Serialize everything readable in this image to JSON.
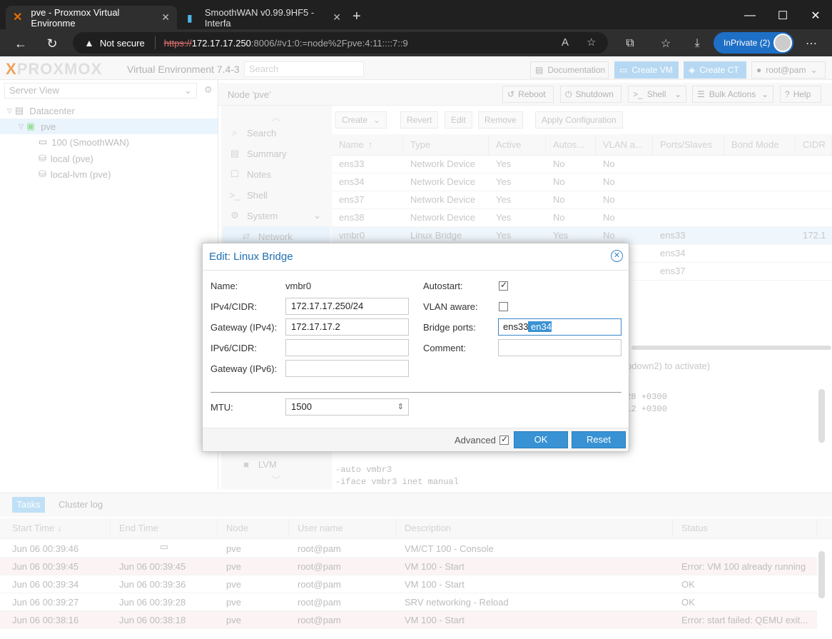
{
  "browser": {
    "tabs": [
      {
        "title": "pve - Proxmox Virtual Environme",
        "icon": "proxmox-icon"
      },
      {
        "title": "SmoothWAN v0.99.9HF5 - Interfa",
        "icon": "smoothwan-icon"
      }
    ],
    "url": {
      "security_label": "Not secure",
      "scheme": "https://",
      "host": "172.17.17.250",
      "rest": ":8006/#v1:0:=node%2Fpve:4:11::::7::9"
    },
    "profile_label": "InPrivate (2)"
  },
  "pve": {
    "brand": "PROXMOX",
    "version_text": "Virtual Environment 7.4-3",
    "search_placeholder": "Search",
    "header_buttons": {
      "documentation": "Documentation",
      "create_vm": "Create VM",
      "create_ct": "Create CT",
      "user": "root@pam"
    },
    "server_view": "Server View",
    "tree": [
      "Datacenter",
      "pve",
      "100 (SmoothWAN)",
      "local (pve)",
      "local-lvm (pve)"
    ],
    "node_title": "Node 'pve'",
    "node_buttons": {
      "reboot": "Reboot",
      "shutdown": "Shutdown",
      "shell": "Shell",
      "bulk_actions": "Bulk Actions",
      "help": "Help"
    },
    "nav": [
      "Search",
      "Summary",
      "Notes",
      "Shell",
      "System",
      "Network",
      "LVM"
    ],
    "grid_toolbar": {
      "create": "Create",
      "revert": "Revert",
      "edit": "Edit",
      "remove": "Remove",
      "apply": "Apply Configuration"
    },
    "grid_columns": [
      "Name",
      "Type",
      "Active",
      "Autos...",
      "VLAN a...",
      "Ports/Slaves",
      "Bond Mode",
      "CIDR"
    ],
    "grid_rows": [
      {
        "name": "ens33",
        "type": "Network Device",
        "active": "Yes",
        "autos": "No",
        "vlan": "No",
        "ports": "",
        "cidr": ""
      },
      {
        "name": "ens34",
        "type": "Network Device",
        "active": "Yes",
        "autos": "No",
        "vlan": "No",
        "ports": "",
        "cidr": ""
      },
      {
        "name": "ens37",
        "type": "Network Device",
        "active": "Yes",
        "autos": "No",
        "vlan": "No",
        "ports": "",
        "cidr": ""
      },
      {
        "name": "ens38",
        "type": "Network Device",
        "active": "Yes",
        "autos": "No",
        "vlan": "No",
        "ports": "",
        "cidr": ""
      },
      {
        "name": "vmbr0",
        "type": "Linux Bridge",
        "active": "Yes",
        "autos": "Yes",
        "vlan": "No",
        "ports": "ens33",
        "cidr": "172.1"
      },
      {
        "name": "",
        "type": "",
        "active": "",
        "autos": "",
        "vlan": "",
        "ports": "ens34",
        "cidr": ""
      },
      {
        "name": "",
        "type": "",
        "active": "",
        "autos": "",
        "vlan": "",
        "ports": "ens37",
        "cidr": ""
      }
    ],
    "log_hint": "pdown2) to activate)",
    "log_lines": [
      "328 +0300",
      "512 +0300",
      "-auto vmbr3",
      "-iface vmbr3 inet manual"
    ]
  },
  "tasks": {
    "tab_tasks": "Tasks",
    "tab_cluster_log": "Cluster log",
    "columns": [
      "Start Time",
      "End Time",
      "Node",
      "User name",
      "Description",
      "Status"
    ],
    "rows": [
      {
        "start": "Jun 06 00:39:46",
        "end": "",
        "node": "pve",
        "user": "root@pam",
        "desc": "VM/CT 100 - Console",
        "status": "",
        "error": false
      },
      {
        "start": "Jun 06 00:39:45",
        "end": "Jun 06 00:39:45",
        "node": "pve",
        "user": "root@pam",
        "desc": "VM 100 - Start",
        "status": "Error: VM 100 already running",
        "error": true
      },
      {
        "start": "Jun 06 00:39:34",
        "end": "Jun 06 00:39:36",
        "node": "pve",
        "user": "root@pam",
        "desc": "VM 100 - Start",
        "status": "OK",
        "error": false
      },
      {
        "start": "Jun 06 00:39:27",
        "end": "Jun 06 00:39:28",
        "node": "pve",
        "user": "root@pam",
        "desc": "SRV networking - Reload",
        "status": "OK",
        "error": false
      },
      {
        "start": "Jun 06 00:38:16",
        "end": "Jun 06 00:38:18",
        "node": "pve",
        "user": "root@pam",
        "desc": "VM 100 - Start",
        "status": "Error: start failed: QEMU exit...",
        "error": true
      }
    ]
  },
  "dialog": {
    "title": "Edit: Linux Bridge",
    "name_label": "Name:",
    "name_value": "vmbr0",
    "ipv4_label": "IPv4/CIDR:",
    "ipv4_value": "172.17.17.250/24",
    "gw4_label": "Gateway (IPv4):",
    "gw4_value": "172.17.17.2",
    "ipv6_label": "IPv6/CIDR:",
    "ipv6_value": "",
    "gw6_label": "Gateway (IPv6):",
    "gw6_value": "",
    "autostart_label": "Autostart:",
    "autostart_checked": true,
    "vlan_label": "VLAN aware:",
    "vlan_checked": false,
    "bridge_ports_label": "Bridge ports:",
    "bridge_ports_plain": "ens33",
    "bridge_ports_selected": " en34",
    "comment_label": "Comment:",
    "comment_value": "",
    "mtu_label": "MTU:",
    "mtu_value": "1500",
    "advanced_label": "Advanced",
    "advanced_checked": true,
    "ok_label": "OK",
    "reset_label": "Reset"
  },
  "colors": {
    "accent": "#3892d3",
    "title_blue": "#1f6fb0",
    "proxmox_orange": "#e57000"
  }
}
